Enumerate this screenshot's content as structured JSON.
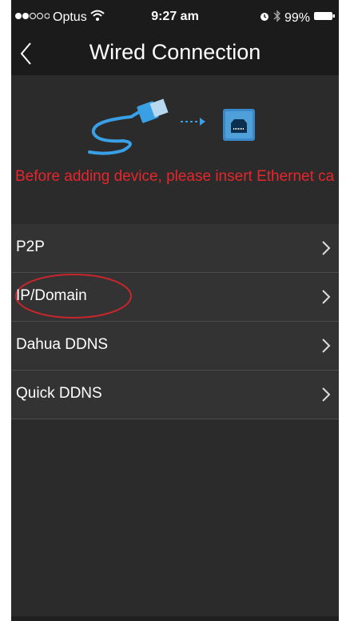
{
  "status": {
    "carrier": "Optus",
    "time": "9:27 am",
    "battery": "99%"
  },
  "nav": {
    "title": "Wired Connection",
    "back_icon": "chevron-left-icon"
  },
  "notice": {
    "text": "Before adding device, please insert Ethernet cable into device to ensure nor...",
    "color": "#e5262c"
  },
  "menu": {
    "items": [
      {
        "label": "P2P"
      },
      {
        "label": "IP/Domain"
      },
      {
        "label": "Dahua DDNS"
      },
      {
        "label": "Quick DDNS"
      }
    ]
  },
  "colors": {
    "accent": "#3aa0e6",
    "highlight_circle": "#c8262c"
  }
}
